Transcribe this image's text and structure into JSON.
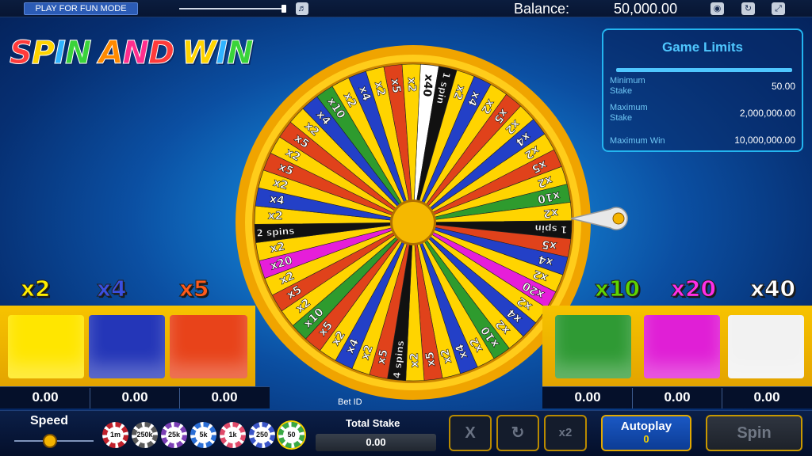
{
  "topbar": {
    "mode_label": "PLAY FOR FUN MODE",
    "volume_level": 0.98,
    "balance_label": "Balance:",
    "balance_value": "50,000.00",
    "icons": [
      "speaker-icon",
      "eye-icon",
      "refresh-icon",
      "fullscreen-icon"
    ]
  },
  "logo": {
    "words": [
      "SPIN",
      "AND",
      "WIN"
    ],
    "letter_colors": [
      "#ff3b3b",
      "#ffd400",
      "#2fb3ff",
      "#3ad43a",
      "#ff8a00",
      "#ff2e8e"
    ]
  },
  "limits": {
    "title": "Game Limits",
    "rows": [
      {
        "label": "Minimum Stake",
        "value": "50.00"
      },
      {
        "label": "Maximum Stake",
        "value": "2,000,000.00"
      },
      {
        "label": "Maximum Win",
        "value": "10,000,000.00"
      }
    ]
  },
  "wheel": {
    "segments": [
      {
        "label": "x40",
        "color": "#ffffff"
      },
      {
        "label": "1 spin",
        "color": "#111111"
      },
      {
        "label": "x2",
        "color": "#ffd400"
      },
      {
        "label": "x4",
        "color": "#2340c7"
      },
      {
        "label": "x2",
        "color": "#ffd400"
      },
      {
        "label": "x5",
        "color": "#e0421b"
      },
      {
        "label": "x2",
        "color": "#ffd400"
      },
      {
        "label": "x4",
        "color": "#2340c7"
      },
      {
        "label": "x2",
        "color": "#ffd400"
      },
      {
        "label": "x5",
        "color": "#e0421b"
      },
      {
        "label": "x2",
        "color": "#ffd400"
      },
      {
        "label": "x10",
        "color": "#2e9b2e"
      },
      {
        "label": "x2",
        "color": "#ffd400"
      },
      {
        "label": "1 spin",
        "color": "#111111"
      },
      {
        "label": "x5",
        "color": "#e0421b"
      },
      {
        "label": "x4",
        "color": "#2340c7"
      },
      {
        "label": "x2",
        "color": "#ffd400"
      },
      {
        "label": "x20",
        "color": "#e61ed9"
      },
      {
        "label": "x2",
        "color": "#ffd400"
      },
      {
        "label": "x4",
        "color": "#2340c7"
      },
      {
        "label": "x2",
        "color": "#ffd400"
      },
      {
        "label": "x10",
        "color": "#2e9b2e"
      },
      {
        "label": "x2",
        "color": "#ffd400"
      },
      {
        "label": "x4",
        "color": "#2340c7"
      },
      {
        "label": "x2",
        "color": "#ffd400"
      },
      {
        "label": "x5",
        "color": "#e0421b"
      },
      {
        "label": "x2",
        "color": "#ffd400"
      },
      {
        "label": "4 spins",
        "color": "#111111"
      },
      {
        "label": "x5",
        "color": "#e0421b"
      },
      {
        "label": "x2",
        "color": "#ffd400"
      },
      {
        "label": "x4",
        "color": "#2340c7"
      },
      {
        "label": "x2",
        "color": "#ffd400"
      },
      {
        "label": "x5",
        "color": "#e0421b"
      },
      {
        "label": "x10",
        "color": "#2e9b2e"
      },
      {
        "label": "x2",
        "color": "#ffd400"
      },
      {
        "label": "x5",
        "color": "#e0421b"
      },
      {
        "label": "x2",
        "color": "#ffd400"
      },
      {
        "label": "x20",
        "color": "#e61ed9"
      },
      {
        "label": "x2",
        "color": "#ffd400"
      },
      {
        "label": "2 spins",
        "color": "#111111"
      },
      {
        "label": "x2",
        "color": "#ffd400"
      },
      {
        "label": "x4",
        "color": "#2340c7"
      },
      {
        "label": "x2",
        "color": "#ffd400"
      },
      {
        "label": "x5",
        "color": "#e0421b"
      },
      {
        "label": "x2",
        "color": "#ffd400"
      },
      {
        "label": "x5",
        "color": "#e0421b"
      },
      {
        "label": "x2",
        "color": "#ffd400"
      },
      {
        "label": "x4",
        "color": "#2340c7"
      },
      {
        "label": "x10",
        "color": "#2e9b2e"
      },
      {
        "label": "x2",
        "color": "#ffd400"
      },
      {
        "label": "x4",
        "color": "#2340c7"
      },
      {
        "label": "x2",
        "color": "#ffd400"
      },
      {
        "label": "x5",
        "color": "#e0421b"
      },
      {
        "label": "x2",
        "color": "#ffd400"
      }
    ]
  },
  "bets": [
    {
      "multiplier": "x2",
      "color": "#ffe600",
      "label_color": "#ffee00",
      "value": "0.00"
    },
    {
      "multiplier": "x4",
      "color": "#2436b8",
      "label_color": "#3b4fe0",
      "value": "0.00"
    },
    {
      "multiplier": "x5",
      "color": "#e8431a",
      "label_color": "#ff5a1a",
      "value": "0.00"
    },
    {
      "multiplier": "x10",
      "color": "#2f9a34",
      "label_color": "#5ed400",
      "value": "0.00"
    },
    {
      "multiplier": "x20",
      "color": "#e01fd6",
      "label_color": "#ff2ee8",
      "value": "0.00"
    },
    {
      "multiplier": "x40",
      "color": "#f2f2f2",
      "label_color": "#ffffff",
      "value": "0.00"
    }
  ],
  "bet_id_label": "Bet ID",
  "bottom": {
    "speed_label": "Speed",
    "speed_level": 0.45,
    "chips": [
      {
        "label": "1m",
        "color": "#c0202b"
      },
      {
        "label": "250k",
        "color": "#5a5a5a"
      },
      {
        "label": "25k",
        "color": "#7b3fb5"
      },
      {
        "label": "5k",
        "color": "#2a6ed6"
      },
      {
        "label": "1k",
        "color": "#e04a6a"
      },
      {
        "label": "250",
        "color": "#3a55c8"
      },
      {
        "label": "50",
        "color": "#3aa845"
      }
    ],
    "total_stake_label": "Total Stake",
    "total_stake_value": "0.00",
    "clear_label": "X",
    "double_label": "x2",
    "autoplay_label": "Autoplay",
    "autoplay_count": "0",
    "spin_label": "Spin"
  }
}
